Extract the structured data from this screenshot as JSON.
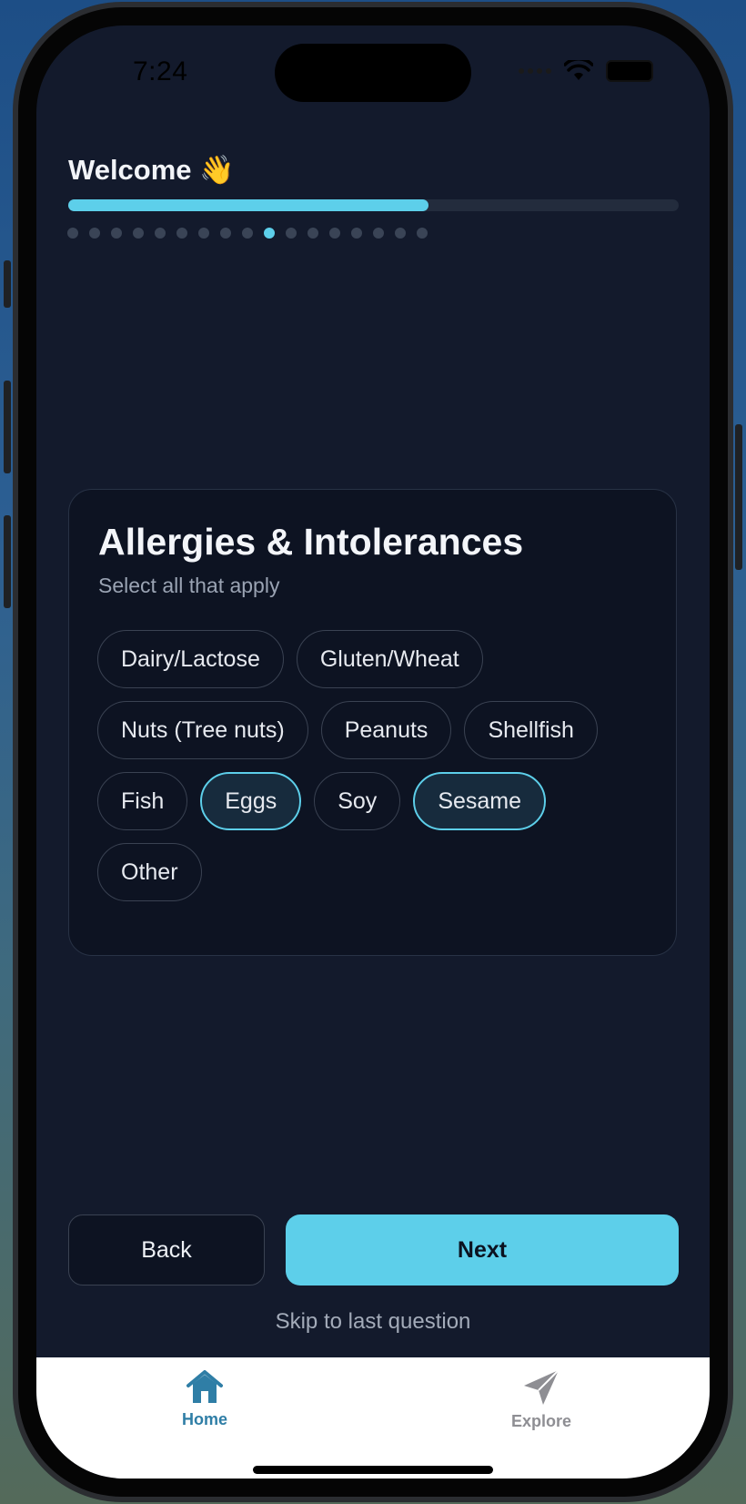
{
  "status_bar": {
    "time": "7:24"
  },
  "header": {
    "title": "Welcome 👋",
    "progress": 0.59,
    "total_steps": 17,
    "current_step": 10
  },
  "question": {
    "title": "Allergies & Intolerances",
    "subtitle": "Select all that apply",
    "options": [
      {
        "label": "Dairy/Lactose",
        "selected": false
      },
      {
        "label": "Gluten/Wheat",
        "selected": false
      },
      {
        "label": "Nuts (Tree nuts)",
        "selected": false
      },
      {
        "label": "Peanuts",
        "selected": false
      },
      {
        "label": "Shellfish",
        "selected": false
      },
      {
        "label": "Fish",
        "selected": false
      },
      {
        "label": "Eggs",
        "selected": true
      },
      {
        "label": "Soy",
        "selected": false
      },
      {
        "label": "Sesame",
        "selected": true
      },
      {
        "label": "Other",
        "selected": false
      }
    ]
  },
  "actions": {
    "back_label": "Back",
    "next_label": "Next",
    "skip_label": "Skip to last question"
  },
  "tabbar": {
    "items": [
      {
        "label": "Home",
        "icon": "home-icon",
        "active": true
      },
      {
        "label": "Explore",
        "icon": "paper-plane-icon",
        "active": false
      }
    ]
  },
  "colors": {
    "accent": "#5dcfea",
    "background": "#131a2c",
    "card": "#0d1322",
    "tab_active": "#2f7ea6"
  }
}
